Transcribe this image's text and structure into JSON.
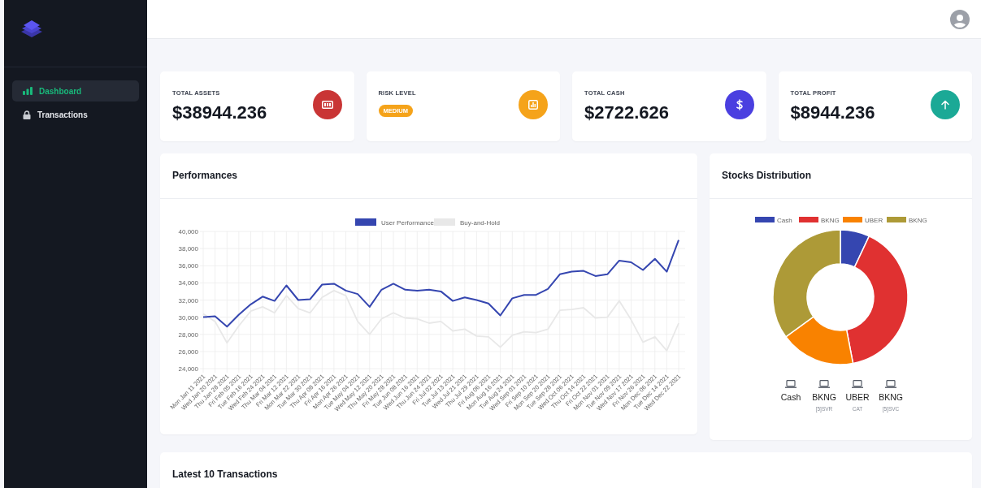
{
  "sidebar": {
    "items": [
      {
        "label": "Dashboard",
        "selected": true
      },
      {
        "label": "Transactions",
        "selected": false
      }
    ]
  },
  "stats": [
    {
      "kind": "value",
      "label": "TOTAL ASSETS",
      "value": "$38944.236",
      "color": "#c93535"
    },
    {
      "kind": "badge",
      "label": "RISK LEVEL",
      "value": "MEDIUM",
      "color": "#f5a31a"
    },
    {
      "kind": "value",
      "label": "TOTAL CASH",
      "value": "$2722.626",
      "color": "#4a3fe0"
    },
    {
      "kind": "value",
      "label": "TOTAL PROFIT",
      "value": "$8944.236",
      "color": "#1ba996"
    }
  ],
  "performances": {
    "title": "Performances",
    "chart_data": {
      "type": "line",
      "categories": [
        "Mon Jan 11 2021",
        "Wed Jan 20 2021",
        "Thu Jan 28 2021",
        "Fri Feb 05 2021",
        "Tue Feb 16 2021",
        "Wed Feb 24 2021",
        "Thu Mar 04 2021",
        "Fri Mar 12 2021",
        "Mon Mar 22 2021",
        "Tue Mar 30 2021",
        "Thu Apr 08 2021",
        "Fri Apr 16 2021",
        "Mon Apr 26 2021",
        "Tue May 04 2021",
        "Wed May 12 2021",
        "Thu May 20 2021",
        "Fri May 28 2021",
        "Tue Jun 08 2021",
        "Wed Jun 16 2021",
        "Thu Jun 24 2021",
        "Fri Jul 02 2021",
        "Tue Jul 13 2021",
        "Wed Jul 21 2021",
        "Thu Jul 29 2021",
        "Fri Aug 06 2021",
        "Mon Aug 16 2021",
        "Tue Aug 24 2021",
        "Wed Sep 01 2021",
        "Fri Sep 10 2021",
        "Mon Sep 20 2021",
        "Tue Sep 28 2021",
        "Wed Oct 06 2021",
        "Thu Oct 14 2021",
        "Fri Oct 22 2021",
        "Mon Nov 01 2021",
        "Tue Nov 09 2021",
        "Wed Nov 17 2021",
        "Fri Nov 26 2021",
        "Mon Dec 06 2021",
        "Tue Dec 14 2021",
        "Wed Dec 22 2021"
      ],
      "series": [
        {
          "name": "User Performance",
          "color": "#3546b0",
          "values": [
            30000,
            30100,
            28900,
            30300,
            31500,
            32400,
            31900,
            33700,
            32000,
            32100,
            33800,
            33900,
            33100,
            32700,
            31200,
            33200,
            33900,
            33200,
            33100,
            33200,
            33000,
            31900,
            32300,
            32000,
            31600,
            30200,
            32200,
            32600,
            32600,
            33300,
            35000,
            35300,
            35400,
            34800,
            35000,
            36600,
            36400,
            35500,
            36800,
            35300,
            39000
          ]
        },
        {
          "name": "Buy-and-Hold",
          "color": "#e8e8e8",
          "values": [
            30400,
            29500,
            27000,
            29000,
            30700,
            31200,
            30500,
            32500,
            31000,
            30500,
            32300,
            33100,
            32500,
            29500,
            28000,
            29800,
            30500,
            29900,
            29800,
            29300,
            29500,
            28400,
            28600,
            27800,
            27700,
            26500,
            27900,
            28300,
            28200,
            28600,
            30800,
            30900,
            31100,
            29900,
            30000,
            31900,
            29700,
            27100,
            27700,
            26100,
            29300
          ]
        }
      ],
      "grid": true,
      "legend": "top",
      "ylim": [
        24000,
        40000
      ],
      "yticks": [
        {
          "value": 24000,
          "label": "24,000"
        },
        {
          "value": 26000,
          "label": "26,000"
        },
        {
          "value": 28000,
          "label": "28,000"
        },
        {
          "value": 30000,
          "label": "30,000"
        },
        {
          "value": 32000,
          "label": "32,000"
        },
        {
          "value": 34000,
          "label": "34,000"
        },
        {
          "value": 36000,
          "label": "36,000"
        },
        {
          "value": 38000,
          "label": "38,000"
        },
        {
          "value": 40000,
          "label": "40,000"
        }
      ]
    }
  },
  "distribution": {
    "title": "Stocks Distribution",
    "chart_data": {
      "type": "donut",
      "categories": [
        "Cash",
        "BKNG",
        "UBER",
        "BKNG"
      ],
      "values": [
        7,
        40,
        18,
        35
      ],
      "legend": "top",
      "colors": [
        "#3546b0",
        "#e03131",
        "#f98200",
        "#ad9a37"
      ]
    },
    "holdings": [
      {
        "name": "Cash"
      },
      {
        "name": "BKNG",
        "sub": "[5]SVR"
      },
      {
        "name": "UBER",
        "sub": "CAT"
      },
      {
        "name": "BKNG",
        "sub": "[5]SVC"
      }
    ]
  },
  "transactions": {
    "title": "Latest 10 Transactions"
  }
}
